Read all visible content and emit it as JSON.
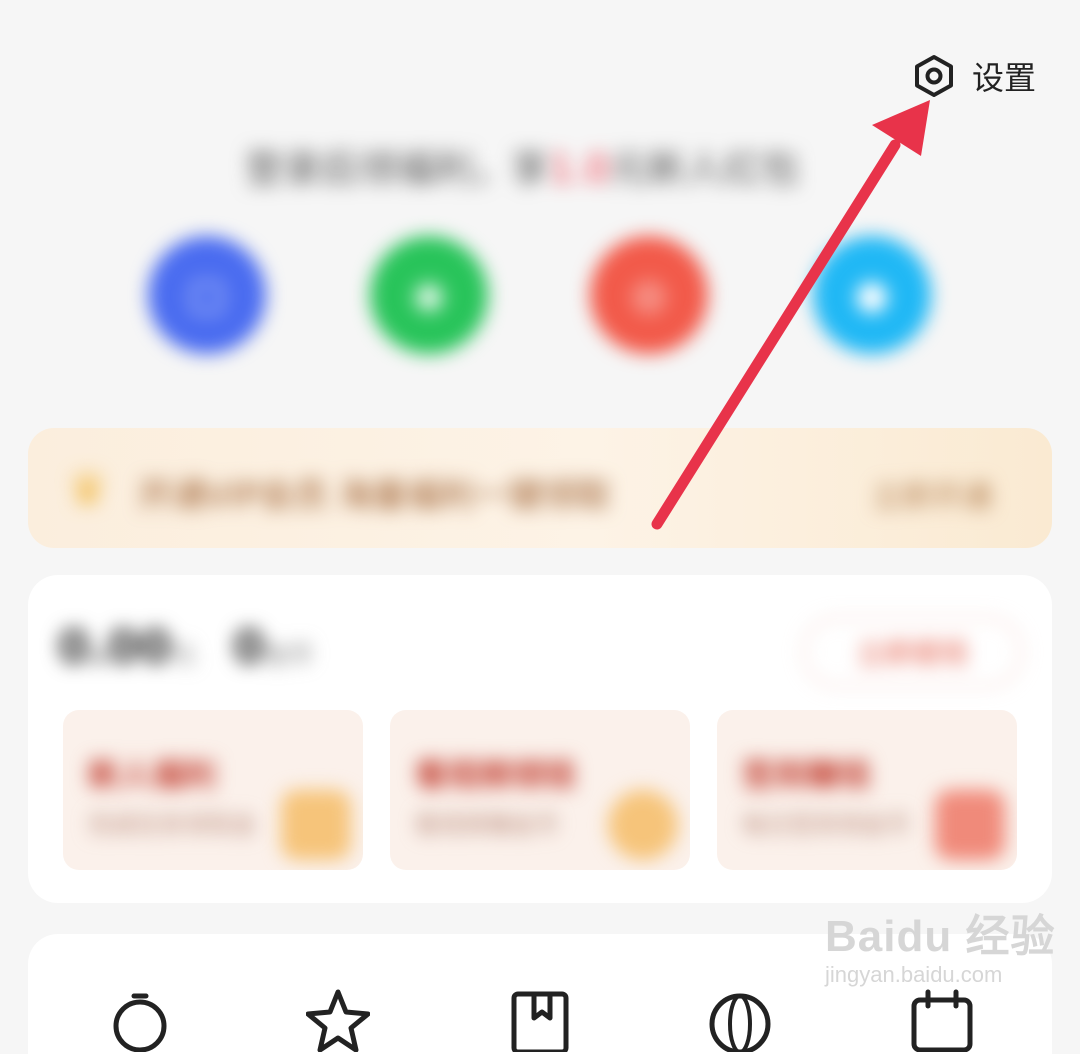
{
  "header": {
    "settings_label": "设置",
    "settings_icon": "hexagon-gear-icon"
  },
  "login_prompt": {
    "text_before": "登录后领福利，享",
    "highlight": "1.0",
    "text_after": "元新人红包"
  },
  "login_options": [
    {
      "name": "blue-login-option",
      "color": "#4a6cf0",
      "glyph": "▢"
    },
    {
      "name": "green-login-option",
      "color": "#28c45a",
      "glyph": "◉"
    },
    {
      "name": "red-login-option",
      "color": "#f25a4a",
      "glyph": "◎"
    },
    {
      "name": "cyan-login-option",
      "color": "#20b8f5",
      "glyph": "●"
    }
  ],
  "vip_banner": {
    "crown_icon": "crown-icon",
    "text": "开通VIP会员 海量福利一键领取",
    "button": "立即开通"
  },
  "assets": {
    "balance": "0.00",
    "balance_unit": "元",
    "coins": "0",
    "coins_unit": "金币",
    "withdraw_button": "立即提现",
    "tiles": [
      {
        "title": "新人福利",
        "subtitle": "完成任务领现金"
      },
      {
        "title": "看视频领钱",
        "subtitle": "看视频赚金币"
      },
      {
        "title": "签到赚钱",
        "subtitle": "每日签到领金币"
      }
    ]
  },
  "tools": [
    "timer-icon",
    "star-icon",
    "bookmark-icon",
    "globe-icon",
    "calendar-icon"
  ],
  "watermark": {
    "main": "Baidu 经验",
    "sub": "jingyan.baidu.com"
  },
  "annotation": {
    "arrow_color": "#e8334a"
  }
}
